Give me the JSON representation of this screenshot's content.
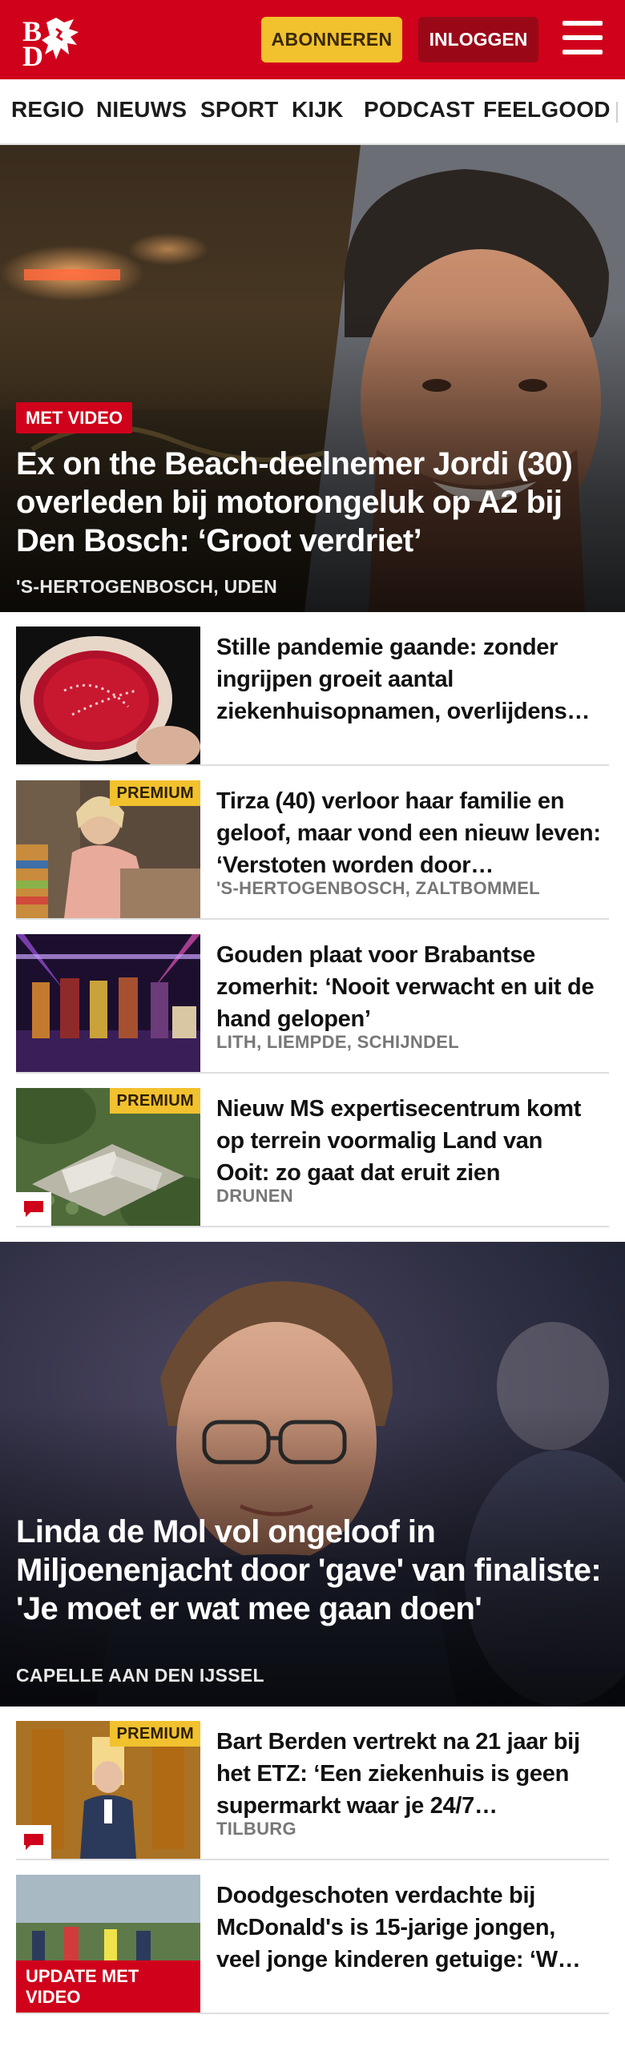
{
  "header": {
    "logo_text": "BD",
    "subscribe_label": "ABONNEREN",
    "login_label": "INLOGGEN",
    "brand_color": "#d0021b",
    "subscribe_color": "#f2c12e",
    "login_color": "#9a0818"
  },
  "nav": {
    "items": [
      "REGIO",
      "NIEUWS",
      "SPORT",
      "KIJK",
      "PODCAST",
      "FEELGOOD"
    ]
  },
  "hero": {
    "badge": "MET VIDEO",
    "title": "Ex on the Beach-deelnemer Jordi (30) overleden bij motorongeluk op A2 bij Den Bosch: ‘Groot verdriet’",
    "tag": "'S-HERTOGENBOSCH, UDEN"
  },
  "articles_1": [
    {
      "title": "Stille pandemie gaande: zonder ingrijpen groeit aantal ziekenhuisopnamen, overlijdens…",
      "tag": "",
      "premium": false,
      "comments": false,
      "thumb": "petri-dish"
    },
    {
      "title": "Tirza (40) verloor haar familie en geloof, maar vond een nieuw leven: ‘Verstoten worden door…",
      "tag": "'S-HERTOGENBOSCH, ZALTBOMMEL",
      "premium": true,
      "comments": false,
      "thumb": "portrait-woman"
    },
    {
      "title": "Gouden plaat voor Brabantse zomerhit: ‘Nooit verwacht en uit de hand gelopen’",
      "tag": "LITH, LIEMPDE, SCHIJNDEL",
      "premium": false,
      "comments": false,
      "thumb": "stage-concert"
    },
    {
      "title": "Nieuw MS expertisecentrum komt op terrein voormalig Land van Ooit: zo gaat dat eruit zien",
      "tag": "DRUNEN",
      "premium": true,
      "comments": true,
      "thumb": "aerial-building"
    }
  ],
  "hero2": {
    "title": "Linda de Mol vol ongeloof in Miljoenenjacht door 'gave' van finaliste: 'Je moet er wat mee gaan doen'",
    "tag": "CAPELLE AAN DEN IJSSEL"
  },
  "articles_2": [
    {
      "title": "Bart Berden vertrekt na 21 jaar bij het ETZ: ‘Een ziekenhuis is geen supermarkt waar je 24/7…",
      "tag": "TILBURG",
      "premium": true,
      "comments": true,
      "thumb": "hospital-corridor"
    },
    {
      "title": "Doodgeschoten verdachte bij McDonald's is 15-jarige jongen, veel jonge kinderen getuige: ‘W…",
      "tag": "",
      "premium": false,
      "comments": false,
      "update_badge": "UPDATE MET VIDEO",
      "thumb": "police-scene"
    }
  ],
  "labels": {
    "premium": "PREMIUM"
  }
}
